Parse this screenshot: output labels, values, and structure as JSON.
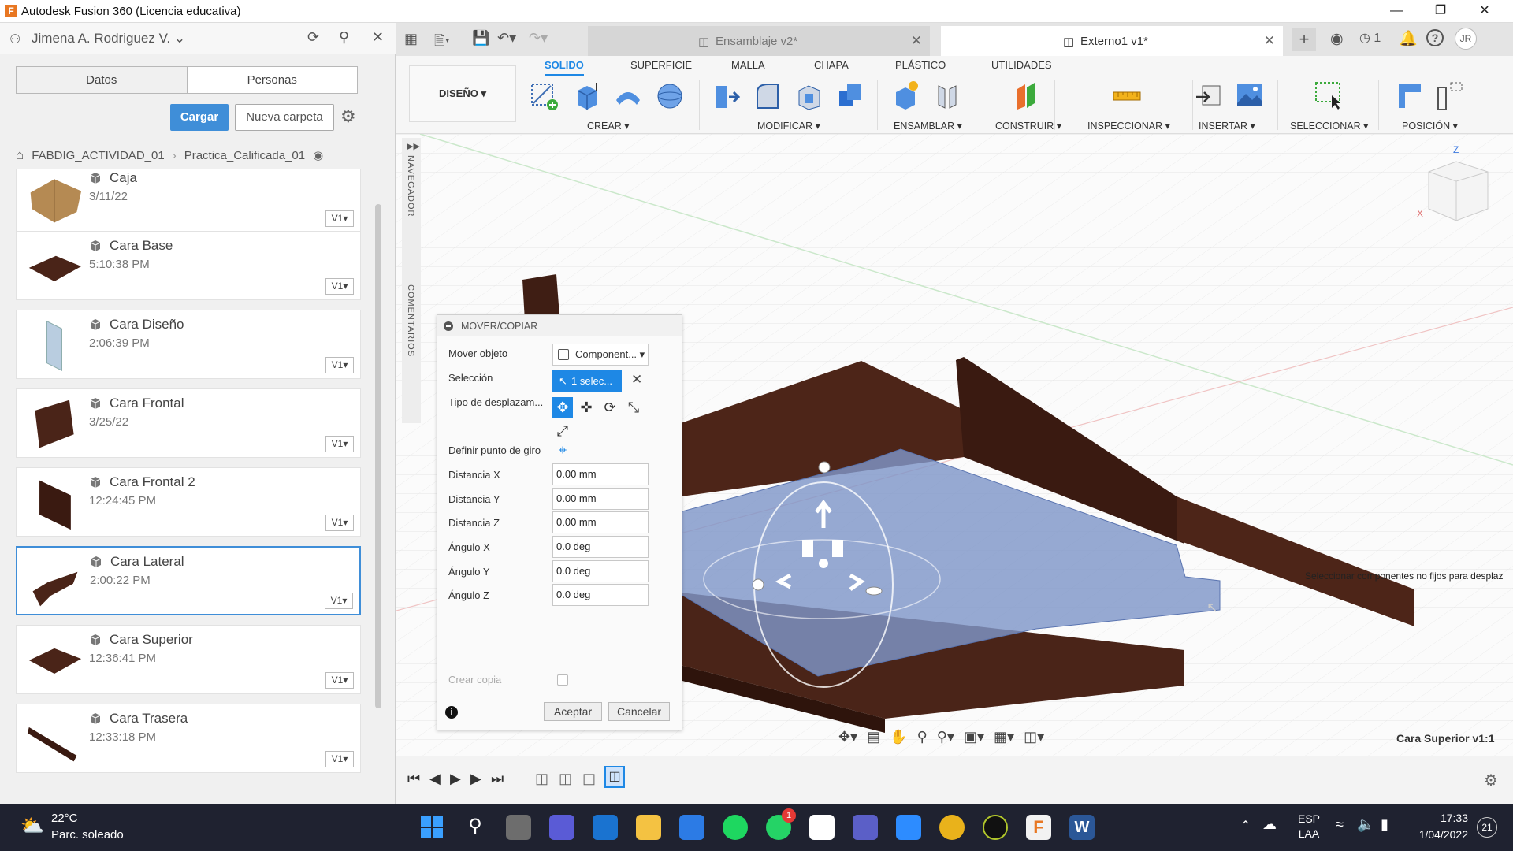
{
  "window": {
    "title": "Autodesk Fusion 360 (Licencia educativa)"
  },
  "data_panel": {
    "user": "Jimena A. Rodriguez V.",
    "tabs": [
      "Datos",
      "Personas"
    ],
    "upload_label": "Cargar",
    "new_folder_label": "Nueva carpeta",
    "breadcrumb": [
      "FABDIG_ACTIVIDAD_01",
      "Practica_Calificada_01"
    ],
    "files": [
      {
        "name": "Caja",
        "date": "3/11/22",
        "version": "V1"
      },
      {
        "name": "Cara Base",
        "date": "5:10:38 PM",
        "version": "V1"
      },
      {
        "name": "Cara Diseño",
        "date": "2:06:39 PM",
        "version": "V1"
      },
      {
        "name": "Cara Frontal",
        "date": "3/25/22",
        "version": "V1"
      },
      {
        "name": "Cara Frontal 2",
        "date": "12:24:45 PM",
        "version": "V1"
      },
      {
        "name": "Cara Lateral",
        "date": "2:00:22 PM",
        "version": "V1"
      },
      {
        "name": "Cara Superior",
        "date": "12:36:41 PM",
        "version": "V1"
      },
      {
        "name": "Cara Trasera",
        "date": "12:33:18 PM",
        "version": "V1"
      }
    ]
  },
  "doc_tabs": [
    {
      "label": "Ensamblaje v2*"
    },
    {
      "label": "Externo1 v1*"
    }
  ],
  "toolbar": {
    "workspace": "DISEÑO",
    "tabs": [
      "SOLIDO",
      "SUPERFICIE",
      "MALLA",
      "CHAPA",
      "PLÁSTICO",
      "UTILIDADES"
    ],
    "groups": [
      "CREAR",
      "MODIFICAR",
      "ENSAMBLAR",
      "CONSTRUIR",
      "INSPECCIONAR",
      "INSERTAR",
      "SELECCIONAR",
      "POSICIÓN"
    ],
    "notifications_count": "1",
    "avatar_initials": "JR"
  },
  "viewport": {
    "side_labels": [
      "NAVEGADOR",
      "COMENTARIOS"
    ],
    "tooltip": "Seleccionar componentes no fijos para desplaz",
    "active_component": "Cara Superior v1:1"
  },
  "dialog": {
    "title": "MOVER/COPIAR",
    "fields": {
      "mover_objeto_label": "Mover objeto",
      "mover_objeto_value": "Component...",
      "seleccion_label": "Selección",
      "seleccion_value": "1 selec...",
      "tipo_label": "Tipo de desplazam...",
      "punto_label": "Definir punto de giro",
      "dist_x_label": "Distancia X",
      "dist_x": "0.00 mm",
      "dist_y_label": "Distancia Y",
      "dist_y": "0.00 mm",
      "dist_z_label": "Distancia Z",
      "dist_z": "0.00 mm",
      "ang_x_label": "Ángulo X",
      "ang_x": "0.0 deg",
      "ang_y_label": "Ángulo Y",
      "ang_y": "0.0 deg",
      "ang_z_label": "Ángulo Z",
      "ang_z": "0.0 deg",
      "copia_label": "Crear copia"
    },
    "ok_label": "Aceptar",
    "cancel_label": "Cancelar"
  },
  "taskbar": {
    "temperature": "22°C",
    "weather": "Parc. soleado",
    "lang_line1": "ESP",
    "lang_line2": "LAA",
    "time": "17:33",
    "date": "1/04/2022",
    "notification_count": "21",
    "whatsapp_badge": "1"
  },
  "colors": {
    "accent": "#1e88e5",
    "wood": "#4a2418",
    "selection": "#7f96c8"
  }
}
